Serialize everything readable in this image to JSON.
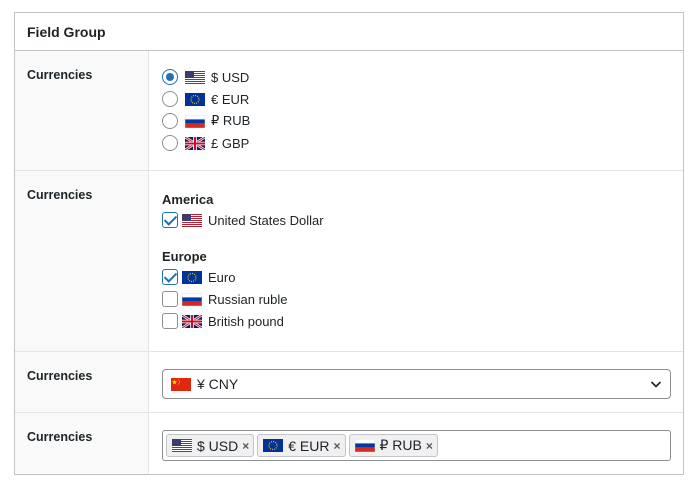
{
  "panel": {
    "title": "Field Group"
  },
  "field_label": "Currencies",
  "radio_field": {
    "label": "Currencies",
    "options": [
      {
        "flag": "us-flag-icon",
        "label": "$ USD",
        "checked": true
      },
      {
        "flag": "eu-flag-icon",
        "label": "€ EUR",
        "checked": false
      },
      {
        "flag": "ru-flag-icon",
        "label": "₽ RUB",
        "checked": false
      },
      {
        "flag": "gb-flag-icon",
        "label": "£ GBP",
        "checked": false
      }
    ]
  },
  "checkbox_field": {
    "label": "Currencies",
    "groups": [
      {
        "heading": "America",
        "items": [
          {
            "flag": "us-flag-icon",
            "label": "United States Dollar",
            "checked": true
          }
        ]
      },
      {
        "heading": "Europe",
        "items": [
          {
            "flag": "eu-flag-icon",
            "label": "Euro",
            "checked": true
          },
          {
            "flag": "ru-flag-icon",
            "label": "Russian ruble",
            "checked": false
          },
          {
            "flag": "gb-flag-icon",
            "label": "British pound",
            "checked": false
          }
        ]
      }
    ]
  },
  "select_field": {
    "label": "Currencies",
    "flag": "cn-flag-icon",
    "value": "¥ CNY"
  },
  "multiselect_field": {
    "label": "Currencies",
    "tags": [
      {
        "flag": "us-flag-icon",
        "label": "$ USD",
        "remove": "×"
      },
      {
        "flag": "eu-flag-icon",
        "label": "€ EUR",
        "remove": "×"
      },
      {
        "flag": "ru-flag-icon",
        "label": "₽ RUB",
        "remove": "×"
      }
    ]
  },
  "colors": {
    "accent": "#2271b1",
    "border": "#c3c4c7",
    "label_bg": "#f9f9f9"
  }
}
